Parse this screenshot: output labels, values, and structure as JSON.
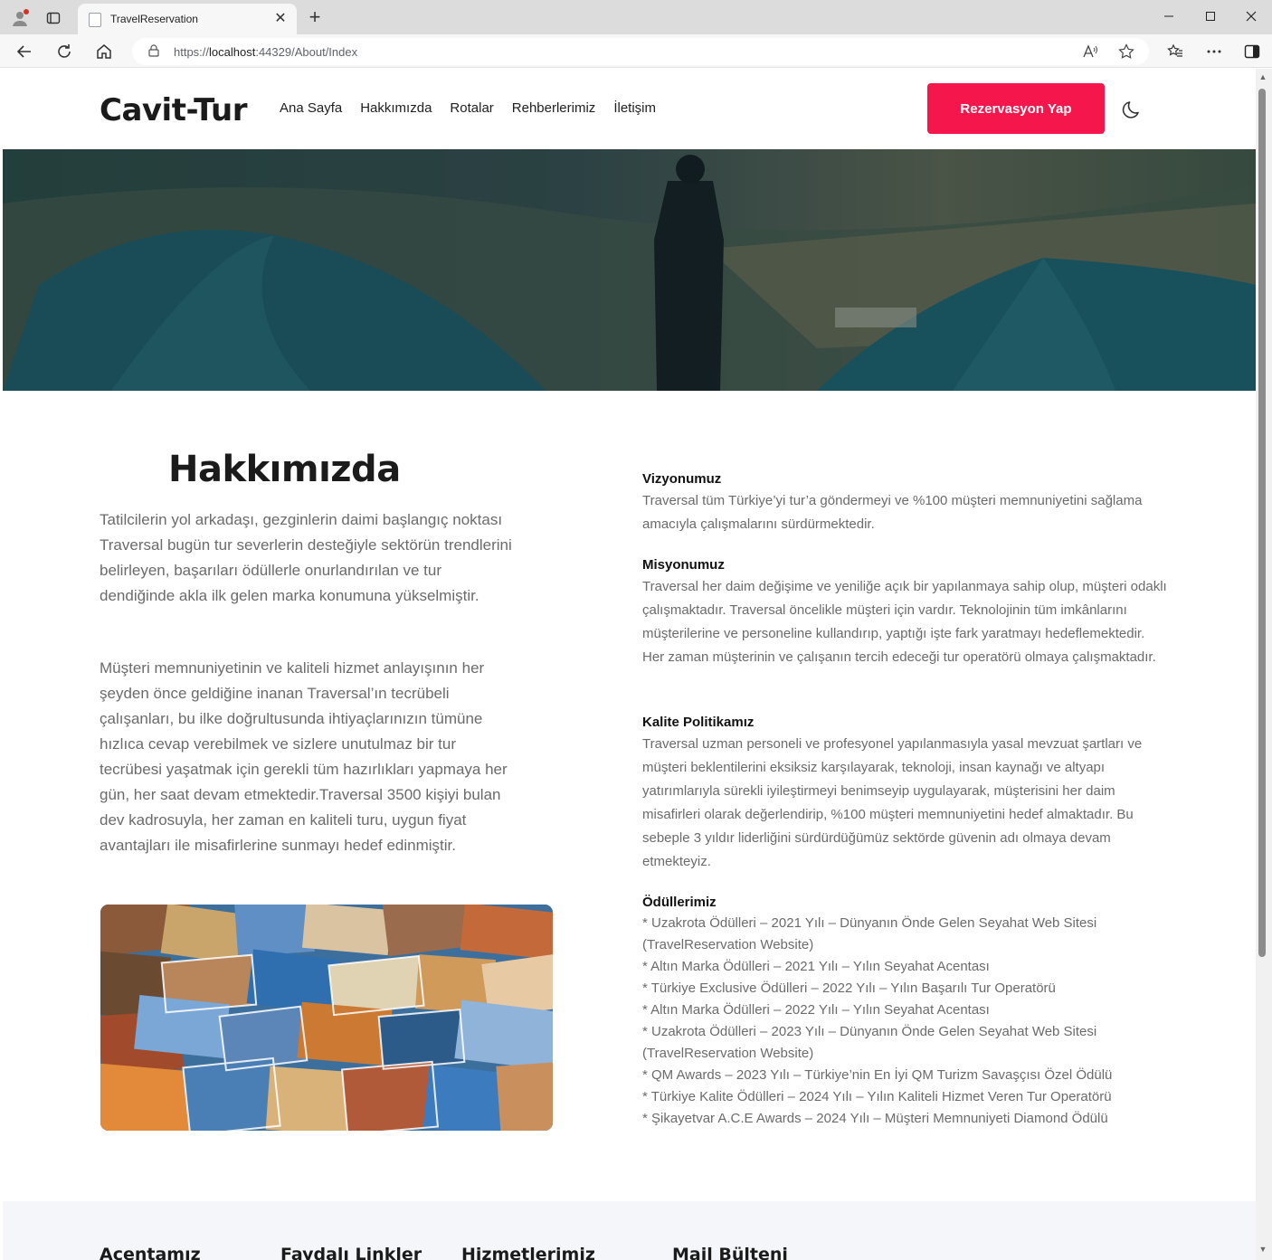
{
  "browser": {
    "tab_title": "TravelReservation",
    "url_prefix": "https://",
    "url_host": "localhost",
    "url_rest": ":44329/About/Index"
  },
  "header": {
    "brand": "Cavit-Tur",
    "nav": [
      "Ana Sayfa",
      "Hakkımızda",
      "Rotalar",
      "Rehberlerimiz",
      "İletişim"
    ],
    "cta_label": "Rezervasyon Yap"
  },
  "about": {
    "title": "Hakkımızda",
    "paragraph_1": "Tatilcilerin yol arkadaşı, gezginlerin daimi başlangıç noktası Traversal bugün tur severlerin desteğiyle sektörün trendlerini belirleyen, başarıları ödüllerle onurlandırılan ve tur dendiğinde akla ilk gelen marka konumuna yükselmiştir.",
    "paragraph_2": "Müşteri memnuniyetinin ve kaliteli hizmet anlayışının her şeyden önce geldiğine inanan Traversal’ın tecrübeli çalışanları, bu ilke doğrultusunda ihtiyaçlarınızın tümüne hızlıca cevap verebilmek ve sizlere unutulmaz bir tur tecrübesi yaşatmak için gerekli tüm hazırlıkları yapmaya her gün, her saat devam etmektedir.Traversal 3500 kişiyi bulan dev kadrosuyla, her zaman en kaliteli turu, uygun fiyat avantajları ile misafirlerine sunmayı hedef edinmiştir."
  },
  "vision": {
    "title": "Vizyonumuz",
    "text": "Traversal tüm Türkiye’yi tur’a göndermeyi ve %100 müşteri memnuniyetini sağlama amacıyla çalışmalarını sürdürmektedir."
  },
  "mission": {
    "title": "Misyonumuz",
    "text": "Traversal her daim değişime ve yeniliğe açık bir yapılanmaya sahip olup, müşteri odaklı çalışmaktadır. Traversal öncelikle müşteri için vardır. Teknolojinin tüm imkânlarını müşterilerine ve personeline kullandırıp, yaptığı işte fark yaratmayı hedeflemektedir. Her zaman müşterinin ve çalışanın tercih edeceği tur operatörü olmaya çalışmaktadır."
  },
  "quality": {
    "title": "Kalite Politikamız",
    "text": "Traversal uzman personeli ve profesyonel yapılanmasıyla yasal mevzuat şartları ve müşteri beklentilerini eksiksiz karşılayarak, teknoloji, insan kaynağı ve altyapı yatırımlarıyla sürekli iyileştirmeyi benimseyip uygulayarak, müşterisini her daim misafirleri olarak değerlendirip, %100 müşteri memnuniyetini hedef almaktadır. Bu sebeple 3 yıldır liderliğini sürdürdüğümüz sektörde güvenin adı olmaya devam etmekteyiz."
  },
  "awards": {
    "title": "Ödüllerimiz",
    "items": [
      "* Uzakrota Ödülleri – 2021 Yılı – Dünyanın Önde Gelen Seyahat Web Sitesi (TravelReservation Website)",
      "* Altın Marka Ödülleri – 2021 Yılı – Yılın Seyahat Acentası",
      "* Türkiye Exclusive Ödülleri – 2022 Yılı – Yılın Başarılı Tur Operatörü",
      "* Altın Marka Ödülleri – 2022 Yılı – Yılın Seyahat Acentası",
      "* Uzakrota Ödülleri – 2023 Yılı – Dünyanın Önde Gelen Seyahat Web Sitesi (TravelReservation Website)",
      "* QM Awards – 2023 Yılı – Türkiye’nin En İyi QM Turizm Savaşçısı Özel Ödülü",
      "* Türkiye Kalite Ödülleri – 2024 Yılı – Yılın Kaliteli Hizmet Veren Tur Operatörü",
      "* Şikayetvar A.C.E Awards – 2024 Yılı – Müşteri Memnuniyeti Diamond Ödülü"
    ]
  },
  "footer": {
    "headings": [
      "Acentamız",
      "Faydalı Linkler",
      "Hizmetlerimiz",
      "Mail Bülteni"
    ]
  },
  "colors": {
    "accent": "#f5174c",
    "text_dark": "#1b1b1b",
    "text_muted": "#6b6b6b",
    "footer_bg": "#f5f6fa"
  }
}
